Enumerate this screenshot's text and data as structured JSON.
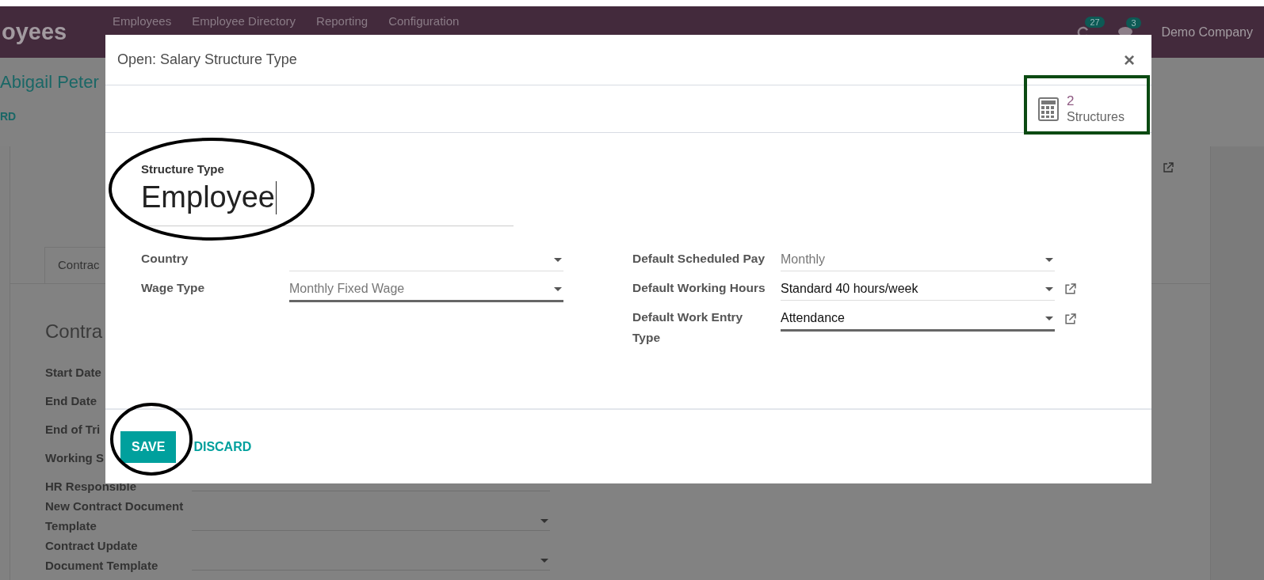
{
  "navbar": {
    "app_title": "oyees",
    "menu": [
      "Employees",
      "Employee Directory",
      "Reporting",
      "Configuration"
    ],
    "activity_count": "27",
    "message_count": "3",
    "company": "Demo Company"
  },
  "background_form": {
    "breadcrumb": "Abigail Peter",
    "button": "RD",
    "tab": "Contrac",
    "section_title": "Contra",
    "rows": [
      {
        "label": "Start Date",
        "field": false
      },
      {
        "label": "End Date",
        "field": false
      },
      {
        "label": "End of Tri",
        "field": false
      },
      {
        "label": "Working S",
        "field": false
      },
      {
        "label": "HR Responsible",
        "field": true
      },
      {
        "label": "New Contract Document Template",
        "field": true
      },
      {
        "label": "Contract Update Document Template",
        "field": true
      }
    ]
  },
  "dialog": {
    "title": "Open: Salary Structure Type",
    "close": "×",
    "smart_button": {
      "count": "2",
      "label": "Structures"
    },
    "name_label": "Structure Type",
    "name_value": "Employee",
    "left_fields": [
      {
        "label": "Country",
        "focused": false,
        "external_link": false
      },
      {
        "label": "Wage Type",
        "value": "Monthly Fixed Wage",
        "focused": true,
        "muted": true,
        "external_link": false
      }
    ],
    "right_fields": [
      {
        "label": "Default Scheduled Pay",
        "value": "Monthly",
        "focused": false,
        "muted": true,
        "external_link": false
      },
      {
        "label": "Default Working Hours",
        "value": "Standard 40 hours/week",
        "focused": false,
        "muted": false,
        "external_link": true
      },
      {
        "label": "Default Work Entry Type",
        "value": "Attendance",
        "focused": true,
        "muted": false,
        "external_link": true
      }
    ],
    "buttons": [
      {
        "label": "SAVE",
        "kind": "primary"
      },
      {
        "label": "DISCARD",
        "kind": "link"
      }
    ]
  },
  "annotations": [
    {
      "kind": "ellipse"
    },
    {
      "kind": "ellipse"
    },
    {
      "kind": "frame"
    }
  ]
}
